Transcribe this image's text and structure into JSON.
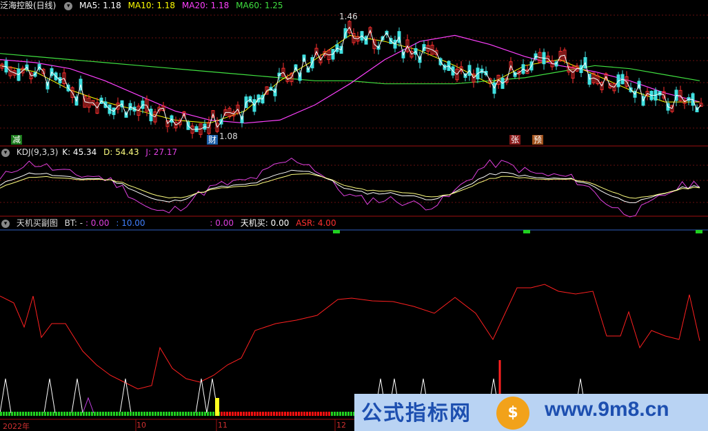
{
  "main_panel": {
    "stock_name": "泛海控股(日线)",
    "ma5": "MA5: 1.18",
    "ma10": "MA10: 1.18",
    "ma20": "MA20: 1.18",
    "ma60": "MA60: 1.25",
    "high_label": "1.46",
    "low_label": "1.08",
    "signals": {
      "jian": "减",
      "cai": "财",
      "zhang": "张",
      "yu": "预"
    },
    "colors": {
      "ma5": "#ffffff",
      "ma10": "#ffff00",
      "ma20": "#ff40ff",
      "ma60": "#40e040",
      "up": "#ff3030",
      "down": "#40e0e0"
    }
  },
  "kdj_panel": {
    "name": "KDJ(9,3,3)",
    "k": "K: 45.34",
    "d": "D: 54.43",
    "j": "J: 27.17"
  },
  "tianji_panel": {
    "name": "天机买副图",
    "bt": "BT: -",
    "v1": ": 0.00",
    "v2": ": 10.00",
    "v3": ": 0.00",
    "tianji_buy": "天机买: 0.00",
    "asr": "ASR: 4.00"
  },
  "date_axis": {
    "year": "2022年",
    "m10": "10",
    "m11": "11",
    "m12": "12"
  },
  "watermark": {
    "text": "公式指标网",
    "logo": "$",
    "url": "www.9m8.cn"
  },
  "icons": [
    "collapse-icon"
  ],
  "chart_data": {
    "type": "line",
    "title": "",
    "series": [
      {
        "name": "MA60",
        "values": [
          1.34,
          1.33,
          1.32,
          1.31,
          1.3,
          1.29,
          1.28,
          1.27,
          1.26,
          1.25,
          1.25,
          1.24,
          1.24,
          1.24,
          1.25,
          1.26,
          1.28,
          1.3,
          1.29,
          1.27,
          1.25
        ]
      },
      {
        "name": "MA20",
        "values": [
          1.32,
          1.31,
          1.29,
          1.25,
          1.2,
          1.15,
          1.12,
          1.11,
          1.12,
          1.17,
          1.24,
          1.32,
          1.38,
          1.4,
          1.37,
          1.33,
          1.3,
          1.28,
          1.25,
          1.21,
          1.18
        ]
      },
      {
        "name": "MA10",
        "values": [
          1.3,
          1.28,
          1.22,
          1.18,
          1.15,
          1.12,
          1.11,
          1.15,
          1.25,
          1.32,
          1.4,
          1.38,
          1.35,
          1.3,
          1.24,
          1.3,
          1.32,
          1.27,
          1.22,
          1.18,
          1.18
        ]
      }
    ],
    "kdj_ylim": [
      0,
      100
    ],
    "candle_high": 1.46,
    "candle_low": 1.08
  }
}
